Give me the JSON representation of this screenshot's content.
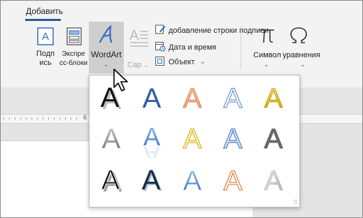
{
  "ribbon": {
    "tab_label": "Добавить",
    "sign_line": "Подп\nись",
    "express_blocks": "Экспре\nсс-блоки",
    "wordart_label": "WordArt",
    "dropcap_label": "Сар",
    "add_signature_line": "добавление строки подписи",
    "date_time": "Дата и время",
    "object": "Объект",
    "symbol": "Символ",
    "equation": "уравнения"
  },
  "ruler": {
    "marker": "6"
  },
  "wordart_gallery": {
    "letter": "A",
    "rows": 3,
    "columns": 5,
    "styles": [
      "black-fill-shadow",
      "blue-fill",
      "orange-fill-light",
      "blue-outline",
      "gold-fill",
      "gray-gradient",
      "blue-reflection",
      "gold-outline",
      "blue-outline-light",
      "gray-bevel",
      "black-fill-white-outline",
      "black-fill-blue-outline",
      "blue-gradient",
      "orange-outline",
      "silver-gradient"
    ]
  },
  "colors": {
    "accent": "#2b579a",
    "wordart_icon": "#2f6fc1"
  }
}
